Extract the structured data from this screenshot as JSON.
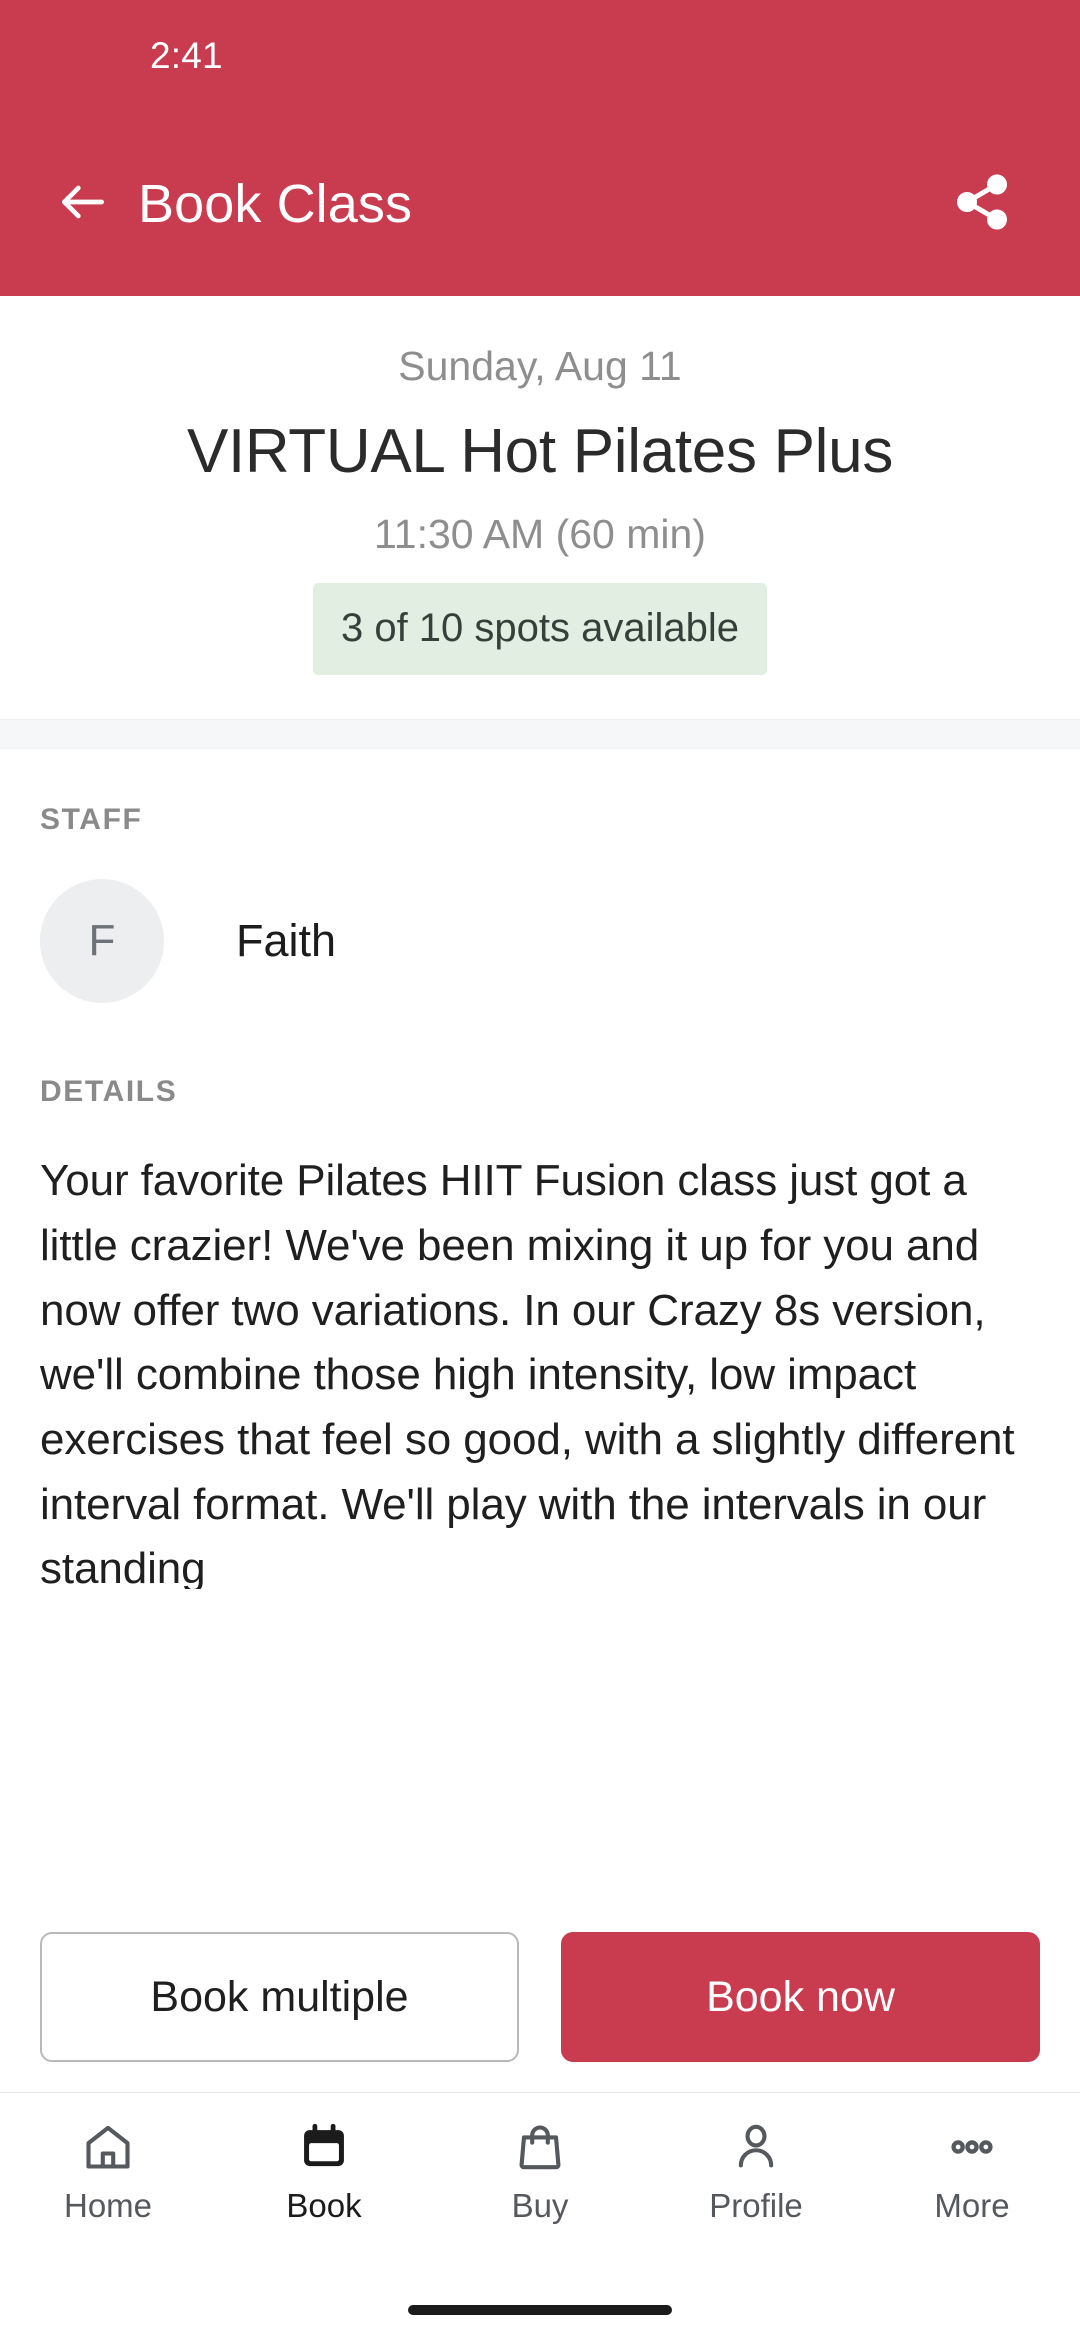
{
  "theme": {
    "brand_red": "#c93c50",
    "badge_green_bg": "#e2eee2",
    "badge_green_text": "#33413a",
    "muted_gray": "#8e8e8e"
  },
  "status_bar": {
    "clock": "2:41"
  },
  "appbar": {
    "title": "Book Class",
    "back_icon": "arrow-left-icon",
    "share_icon": "share-icon"
  },
  "class_summary": {
    "date": "Sunday, Aug 11",
    "title": "VIRTUAL Hot Pilates Plus",
    "time": "11:30 AM (60 min)",
    "spots": "3 of 10 spots available"
  },
  "staff_section": {
    "label": "STAFF",
    "avatar_initial": "F",
    "name": "Faith"
  },
  "details_section": {
    "label": "DETAILS",
    "text": "Your favorite Pilates HIIT Fusion class just got a little crazier!   We've been mixing it up for you and now offer two variations. In our Crazy 8s version, we'll combine those high intensity, low impact exercises that feel so good, with a slightly different interval format. We'll play with the intervals in our standing"
  },
  "actions": {
    "secondary_label": "Book multiple",
    "primary_label": "Book now"
  },
  "bottom_nav": {
    "items": [
      {
        "label": "Home",
        "icon": "home-icon",
        "active": false
      },
      {
        "label": "Book",
        "icon": "calendar-icon",
        "active": true
      },
      {
        "label": "Buy",
        "icon": "shopping-bag-icon",
        "active": false
      },
      {
        "label": "Profile",
        "icon": "person-icon",
        "active": false
      },
      {
        "label": "More",
        "icon": "more-horizontal-icon",
        "active": false
      }
    ]
  }
}
